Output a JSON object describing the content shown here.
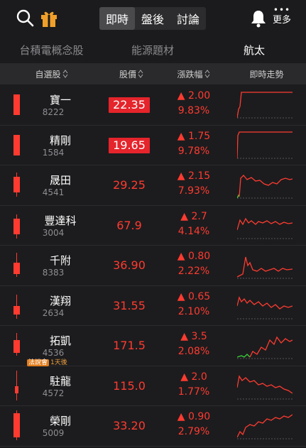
{
  "topbar": {
    "tabs": [
      "即時",
      "盤後",
      "討論"
    ],
    "active_tab": 0,
    "more_dots": "•••",
    "more_label": "更多"
  },
  "categories": [
    "台積電概念股",
    "能源題材",
    "航太"
  ],
  "active_category": 2,
  "header": {
    "col_watchlist": "自選股",
    "col_price": "股價",
    "col_change": "漲跌幅",
    "col_trend": "即時走勢"
  },
  "stocks": [
    {
      "name": "寶一",
      "code": "8222",
      "price": "22.35",
      "change": "▲ 2.00",
      "pct": "9.83%",
      "limit_up": true
    },
    {
      "name": "精剛",
      "code": "1584",
      "price": "19.65",
      "change": "▲ 1.75",
      "pct": "9.78%",
      "limit_up": true
    },
    {
      "name": "晟田",
      "code": "4541",
      "price": "29.25",
      "change": "▲ 2.15",
      "pct": "7.93%",
      "limit_up": false
    },
    {
      "name": "豐達科",
      "code": "3004",
      "price": "67.9",
      "change": "▲ 2.7",
      "pct": "4.14%",
      "limit_up": false
    },
    {
      "name": "千附",
      "code": "8383",
      "price": "36.90",
      "change": "▲ 0.80",
      "pct": "2.22%",
      "limit_up": false
    },
    {
      "name": "漢翔",
      "code": "2634",
      "price": "31.55",
      "change": "▲ 0.65",
      "pct": "2.10%",
      "limit_up": false
    },
    {
      "name": "拓凱",
      "code": "4536",
      "price": "171.5",
      "change": "▲ 3.5",
      "pct": "2.08%",
      "limit_up": false,
      "badge": "法說會",
      "badge_note": "1天後"
    },
    {
      "name": "駐龍",
      "code": "4572",
      "price": "115.0",
      "change": "▲ 2.0",
      "pct": "1.77%",
      "limit_up": false
    },
    {
      "name": "榮剛",
      "code": "5009",
      "price": "33.20",
      "change": "▲ 0.90",
      "pct": "2.79%",
      "limit_up": false
    }
  ],
  "colors": {
    "up": "#ff3b30",
    "limit_bg": "#e5242b",
    "bg": "#1b1b1d",
    "header_bg": "#2a2a2c"
  }
}
